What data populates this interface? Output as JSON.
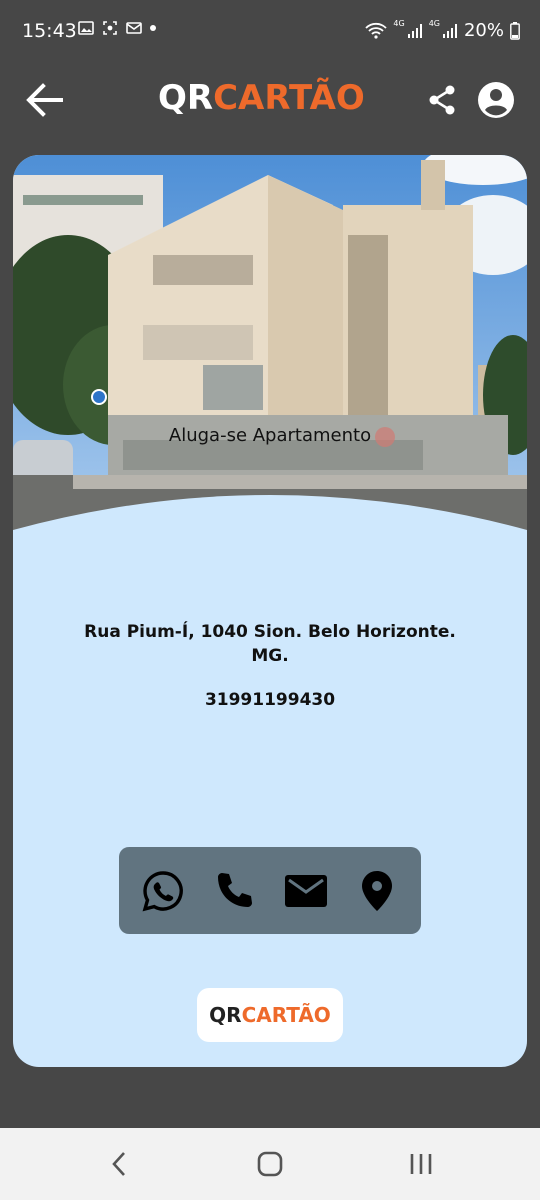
{
  "status_bar": {
    "time": "15:43",
    "network_1": "4G",
    "network_2": "4G",
    "battery": "20%"
  },
  "header": {
    "logo_qr": "QR",
    "logo_cartao": "CARTÃO",
    "icons": [
      "back-arrow-icon",
      "share-icon",
      "account-circle-icon"
    ]
  },
  "card": {
    "cover_caption": "Aluga-se Apartamento",
    "address": "Rua Pium-Í, 1040 Sion. Belo Horizonte. MG.",
    "phone": "31991199430",
    "contact_icons": [
      "whatsapp-icon",
      "phone-icon",
      "email-icon",
      "location-pin-icon"
    ],
    "footer_logo_qr": "QR",
    "footer_logo_cartao": "CARTÃO"
  },
  "colors": {
    "background": "#474747",
    "card": "#cfe8fd",
    "brand_orange": "#ee6a2b",
    "contact_bar": "#617480"
  }
}
